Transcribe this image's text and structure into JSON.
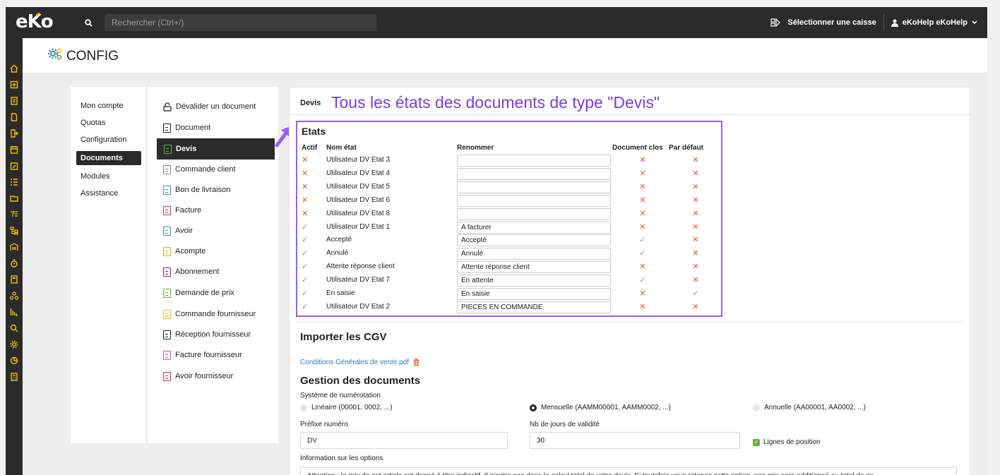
{
  "app": {
    "logo": "eKo"
  },
  "topbar": {
    "search_placeholder": "Rechercher (Ctrl+/)",
    "select_caisse": "Sélectionner une caisse",
    "user": "eKoHelp eKoHelp"
  },
  "header": {
    "title": "CONFIG"
  },
  "menu1": [
    "Mon compte",
    "Quotas",
    "Configuration",
    "Documents",
    "Modules",
    "Assistance"
  ],
  "menu1_active": "Documents",
  "menu2": [
    {
      "label": "Dévalider un document",
      "color": "#222222"
    },
    {
      "label": "Document",
      "color": "#222222"
    },
    {
      "label": "Devis",
      "color": "#63b04b"
    },
    {
      "label": "Commande client",
      "color": "#7a8fa6"
    },
    {
      "label": "Bon de livraison",
      "color": "#3a8fd6"
    },
    {
      "label": "Facture",
      "color": "#d9342b"
    },
    {
      "label": "Avoir",
      "color": "#3a8fd6"
    },
    {
      "label": "Acompte",
      "color": "#f0a020"
    },
    {
      "label": "Abonnement",
      "color": "#8e1f6b"
    },
    {
      "label": "Demande de prix",
      "color": "#63b04b"
    },
    {
      "label": "Commande fournisseur",
      "color": "#f2c200"
    },
    {
      "label": "Réception fournisseur",
      "color": "#222222"
    },
    {
      "label": "Facture fournisseur",
      "color": "#e04a9a"
    },
    {
      "label": "Avoir fournisseur",
      "color": "#d9342b"
    }
  ],
  "main": {
    "tab": "Devis",
    "annotation": "Tous les états des documents de type \"Devis\"",
    "etats": {
      "title": "Etats",
      "headers": {
        "actif": "Actif",
        "nom": "Nom état",
        "renommer": "Renommer",
        "clos": "Document clos",
        "defaut": "Par défaut"
      },
      "rows": [
        {
          "actif": false,
          "nom": "Utilisateur DV Etat 3",
          "renommer": "",
          "clos": false,
          "defaut": false
        },
        {
          "actif": false,
          "nom": "Utilisateur DV Etat 4",
          "renommer": "",
          "clos": false,
          "defaut": false
        },
        {
          "actif": false,
          "nom": "Utilisateur DV Etat 5",
          "renommer": "",
          "clos": false,
          "defaut": false
        },
        {
          "actif": false,
          "nom": "Utilisateur DV Etat 6",
          "renommer": "",
          "clos": false,
          "defaut": false
        },
        {
          "actif": false,
          "nom": "Utilisateur DV Etat 8",
          "renommer": "",
          "clos": false,
          "defaut": false
        },
        {
          "actif": true,
          "nom": "Utilisateur DV Etat 1",
          "renommer": "A facturer",
          "clos": false,
          "defaut": false
        },
        {
          "actif": true,
          "nom": "Accepté",
          "renommer": "Accepté",
          "clos": true,
          "defaut": false
        },
        {
          "actif": true,
          "nom": "Annulé",
          "renommer": "Annulé",
          "clos": true,
          "defaut": false
        },
        {
          "actif": true,
          "nom": "Attente réponse client",
          "renommer": "Attente réponse client",
          "clos": false,
          "defaut": false
        },
        {
          "actif": true,
          "nom": "Utilisateur DV Etat 7",
          "renommer": "En attente",
          "clos": true,
          "defaut": false
        },
        {
          "actif": true,
          "nom": "En saisie",
          "renommer": "En saisie",
          "clos": false,
          "defaut": true
        },
        {
          "actif": true,
          "nom": "Utilisateur DV Etat 2",
          "renommer": "PIECES EN COMMANDE",
          "clos": false,
          "defaut": false
        }
      ]
    },
    "cgv": {
      "title": "Importer les CGV",
      "file": "Conditions Générales de vente.pdf"
    },
    "gestion": {
      "title": "Gestion des documents",
      "numerotation_label": "Système de numérotation",
      "options": [
        "Linéaire (00001, 0002, ...)",
        "Mensuelle (AAMM00001, AAMM0002, ...)",
        "Annuelle (AA00001, AA0002, ...)"
      ],
      "selected_option": "Mensuelle (AAMM00001, AAMM0002, ...)",
      "prefixe_label": "Préfixe numéro",
      "prefixe_value": "DV",
      "validite_label": "Nb de jours de validité",
      "validite_value": "30",
      "lignes_position": "Lignes de position",
      "lignes_position_checked": true,
      "info_label": "Information sur les options",
      "info_text": "Attention : le prix de cet article est donné à titre indicatif. Il n'entre pas dans le calcul total de votre devis. Si toutefois vous retenez cette option, son prix sera additionné au total de ce"
    }
  }
}
